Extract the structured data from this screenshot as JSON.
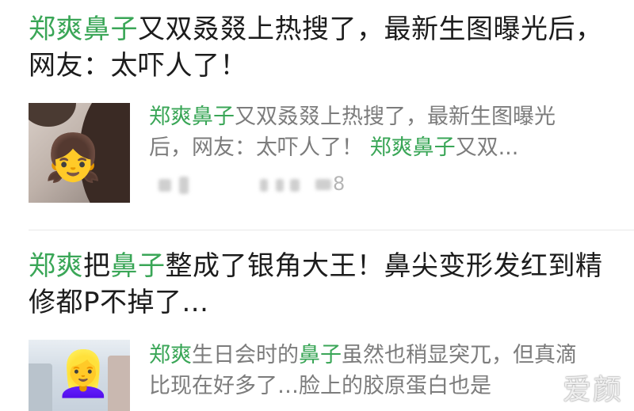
{
  "results": [
    {
      "title": [
        {
          "text": "郑爽鼻子",
          "highlight": true
        },
        {
          "text": "又双叒叕上热搜了，最新生图曝光后，网友：太吓人了！",
          "highlight": false
        }
      ],
      "snippet": [
        {
          "text": "郑爽鼻子",
          "highlight": true
        },
        {
          "text": "又双叒叕上热搜了，最新生图曝光后，网友：太吓人了！ ",
          "highlight": false
        },
        {
          "text": "郑爽鼻子",
          "highlight": true
        },
        {
          "text": "又双...",
          "highlight": false
        }
      ],
      "thumbnail_emoji": "👧",
      "meta_count": "8"
    },
    {
      "title": [
        {
          "text": "郑爽",
          "highlight": true
        },
        {
          "text": "把",
          "highlight": false
        },
        {
          "text": "鼻子",
          "highlight": true
        },
        {
          "text": "整成了银角大王！鼻尖变形发红到精修都P不掉了...",
          "highlight": false
        }
      ],
      "snippet": [
        {
          "text": "郑爽",
          "highlight": true
        },
        {
          "text": "生日会时的",
          "highlight": false
        },
        {
          "text": "鼻子",
          "highlight": true
        },
        {
          "text": "虽然也稍显突兀，但真滴比现在好多了…脸上的胶原蛋白也是",
          "highlight": false
        }
      ],
      "thumbnail_emoji": "👱‍♀️"
    }
  ],
  "watermark": "爱颜",
  "colors": {
    "highlight": "#3aa657",
    "title": "#1c1c1c",
    "snippet": "#7c7c7c"
  }
}
